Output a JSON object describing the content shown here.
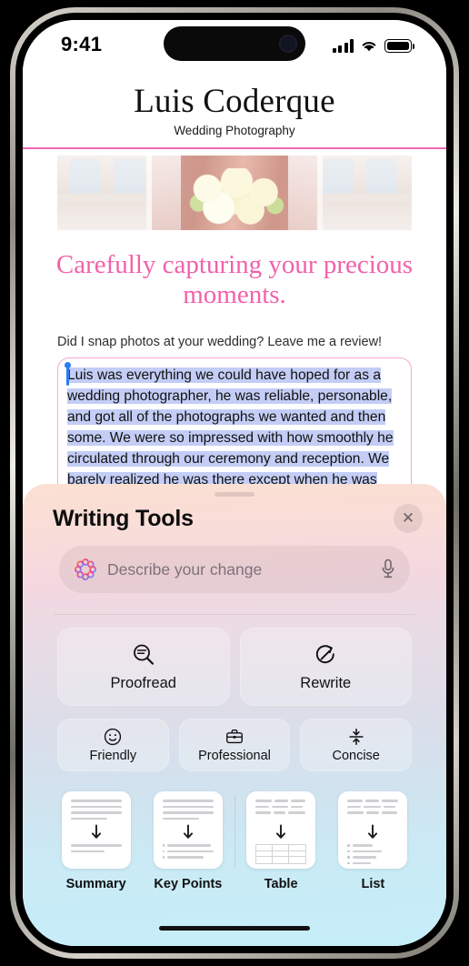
{
  "status_bar": {
    "time": "9:41",
    "icons": [
      "cellular-signal-icon",
      "wifi-icon",
      "battery-icon"
    ]
  },
  "site": {
    "brand_name": "Luis Coderque",
    "tagline": "Wedding Photography",
    "hero_photo_alt": "bride holding white bouquet",
    "headline": "Carefully capturing your precious moments.",
    "review_prompt": "Did I snap photos at your wedding? Leave me a review!",
    "review_text": "Luis was everything we could have hoped for as a wedding photographer, he was reliable, personable, and got all of the photographs we wanted and then some. We were so impressed with how smoothly he circulated through our ceremony and reception. We barely realized he was there except when he was very"
  },
  "writing_tools": {
    "title": "Writing Tools",
    "close_label": "✕",
    "prompt_placeholder": "Describe your change",
    "main_actions": [
      {
        "label": "Proofread",
        "icon": "proofread-magnifier-icon"
      },
      {
        "label": "Rewrite",
        "icon": "rewrite-circular-arrow-icon"
      }
    ],
    "tone_actions": [
      {
        "label": "Friendly",
        "icon": "smiley-face-icon"
      },
      {
        "label": "Professional",
        "icon": "briefcase-icon"
      },
      {
        "label": "Concise",
        "icon": "compress-arrows-icon"
      }
    ],
    "format_actions": [
      {
        "label": "Summary",
        "icon": "summary-document-icon"
      },
      {
        "label": "Key Points",
        "icon": "key-points-document-icon"
      },
      {
        "label": "Table",
        "icon": "table-document-icon"
      },
      {
        "label": "List",
        "icon": "list-document-icon"
      }
    ]
  },
  "colors": {
    "accent_pink": "#f261ab",
    "border_pink": "#f6a8d2",
    "selection_blue": "#c3cdf5",
    "cursor_blue": "#2b7cf6",
    "sheet_top": "#fbe0d2",
    "sheet_bottom": "#c6eef9"
  }
}
